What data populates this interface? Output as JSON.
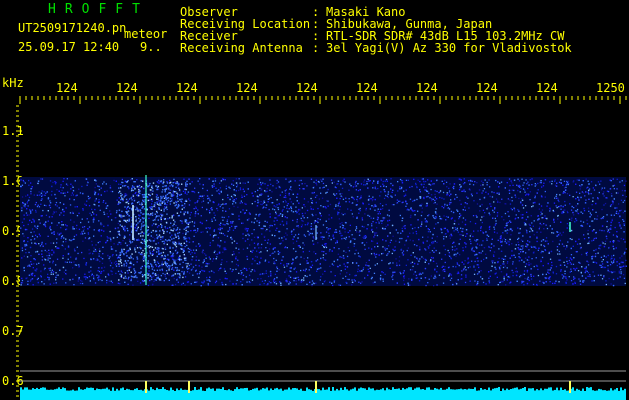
{
  "header": {
    "station_code": "HROFFT",
    "filename": "UT2509171240.pn",
    "tag": "meteor",
    "datetime": "25.09.17 12:40",
    "count": "9..",
    "fields": [
      {
        "label": "Observer",
        "value": "Masaki Kano"
      },
      {
        "label": "Receiving Location",
        "value": "Shibukawa, Gunma, Japan"
      },
      {
        "label": "Receiver",
        "value": "RTL-SDR SDR# 43dB L15 103.2MHz CW"
      },
      {
        "label": "Receiving Antenna",
        "value": "3el Yagi(V) Az 330 for Vladivostok"
      }
    ],
    "separator": ":"
  },
  "axes": {
    "y_unit": "kHz",
    "y_ticks": [
      "1.1",
      "1.0",
      "0.9",
      "0.8",
      "0.7",
      "0.6"
    ],
    "x_ticks": [
      "124",
      "124",
      "124",
      "124",
      "124",
      "124",
      "124",
      "124",
      "124",
      "1250"
    ]
  },
  "colors": {
    "header_text": "#ffff00",
    "title": "#00e000",
    "axis": "#ffff00",
    "background": "#000000",
    "band": "#1010c0",
    "baseline": "#00e5ff"
  }
}
